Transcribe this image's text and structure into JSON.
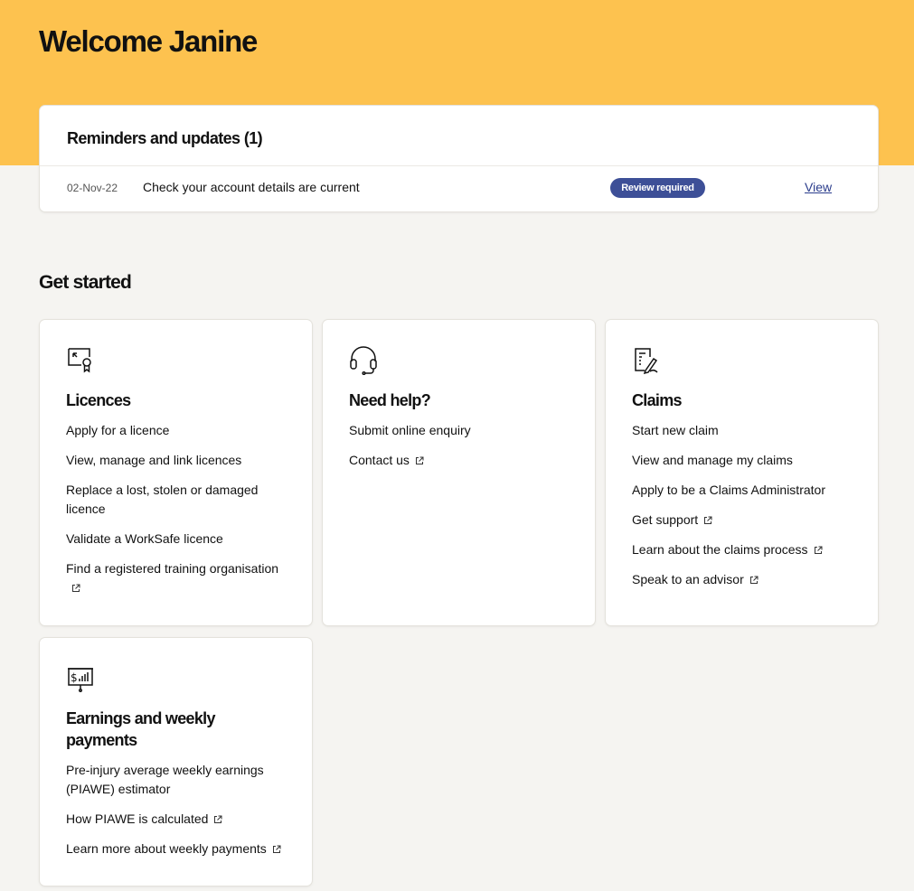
{
  "header": {
    "welcome": "Welcome Janine"
  },
  "reminders": {
    "title": "Reminders and updates (1)",
    "items": [
      {
        "date": "02-Nov-22",
        "text": "Check your account details are current",
        "status": "Review required",
        "action": "View"
      }
    ]
  },
  "get_started": {
    "title": "Get started",
    "tiles": [
      {
        "icon": "licence-certificate-icon",
        "title": "Licences",
        "links": [
          {
            "label": "Apply for a licence",
            "external": false
          },
          {
            "label": "View, manage and link licences",
            "external": false
          },
          {
            "label": "Replace a lost, stolen or damaged licence",
            "external": false
          },
          {
            "label": "Validate a WorkSafe licence",
            "external": false
          },
          {
            "label": "Find a registered training organisation",
            "external": true
          }
        ]
      },
      {
        "icon": "headset-icon",
        "title": "Need help?",
        "links": [
          {
            "label": "Submit online enquiry",
            "external": false
          },
          {
            "label": "Contact us",
            "external": true
          }
        ]
      },
      {
        "icon": "claims-document-icon",
        "title": "Claims",
        "links": [
          {
            "label": "Start new claim",
            "external": false
          },
          {
            "label": "View and manage my claims",
            "external": false
          },
          {
            "label": "Apply to be a Claims Administrator",
            "external": false
          },
          {
            "label": "Get support",
            "external": true
          },
          {
            "label": "Learn about the claims process",
            "external": true
          },
          {
            "label": "Speak to an advisor",
            "external": true
          }
        ]
      },
      {
        "icon": "earnings-chart-icon",
        "title": "Earnings and weekly payments",
        "links": [
          {
            "label": "Pre-injury average weekly earnings (PIAWE) estimator",
            "external": false
          },
          {
            "label": "How PIAWE is calculated",
            "external": true
          },
          {
            "label": "Learn more about weekly payments",
            "external": true
          }
        ]
      }
    ]
  },
  "colors": {
    "hero": "#fdc24f",
    "background": "#f5f4f1",
    "badge": "#3d4f97",
    "link": "#2b3d8c"
  }
}
